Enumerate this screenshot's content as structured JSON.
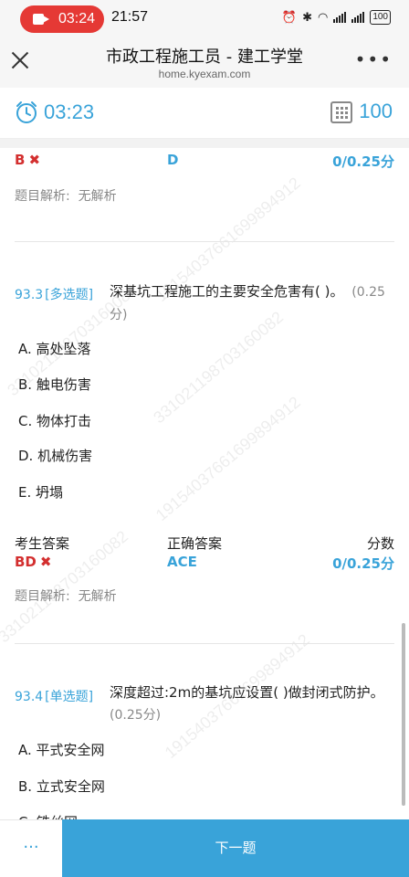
{
  "statusbar": {
    "recording_time": "03:24",
    "clock": "21:57",
    "battery": "100"
  },
  "nav": {
    "title": "市政工程施工员 - 建工学堂",
    "subtitle": "home.kyexam.com",
    "more": "•••"
  },
  "timer": {
    "time": "03:23",
    "count": "100"
  },
  "prev": {
    "user_answer": "B",
    "mark": "✖",
    "correct_answer": "D",
    "score": "0/0.25分",
    "analysis_label": "题目解析:",
    "analysis_value": "无解析"
  },
  "q933": {
    "number": "93.3",
    "type": "[多选题]",
    "text": "深基坑工程施工的主要安全危害有( )。",
    "points": "(0.25分)",
    "options": [
      "A. 高处坠落",
      "B. 触电伤害",
      "C. 物体打击",
      "D. 机械伤害",
      "E. 坍塌"
    ],
    "labels": {
      "user": "考生答案",
      "correct": "正确答案",
      "score": "分数"
    },
    "user_answer": "BD",
    "mark": "✖",
    "correct_answer": "ACE",
    "score": "0/0.25分",
    "analysis_label": "题目解析:",
    "analysis_value": "无解析"
  },
  "q934": {
    "number": "93.4",
    "type": "[单选题]",
    "text": "深度超过:2m的基坑应设置( )做封闭式防护。",
    "points": "(0.25分)",
    "options": [
      "A. 平式安全网",
      "B. 立式安全网",
      "C. 铁丝网"
    ]
  },
  "watermarks": [
    "19154037661699894912",
    "33102119870316008​2",
    "19154037661699894912",
    "331021198703160082",
    "19154037661699894912",
    "331021198703160082"
  ],
  "bottom": {
    "more_label": "···",
    "next_label": "下一题"
  },
  "colors": {
    "accent": "#39a3d9",
    "error": "#d32f2f"
  }
}
